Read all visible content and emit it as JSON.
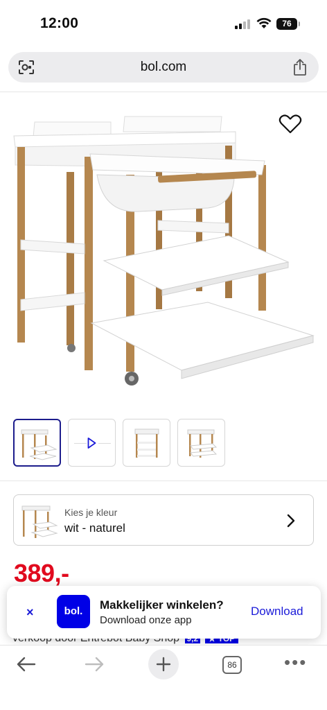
{
  "status_bar": {
    "time": "12:00",
    "battery": "76"
  },
  "browser": {
    "url": "bol.com"
  },
  "gallery": {
    "thumbnails": [
      {
        "kind": "image",
        "selected": true
      },
      {
        "kind": "video",
        "icon": "play-icon"
      },
      {
        "kind": "image"
      },
      {
        "kind": "image"
      }
    ]
  },
  "variant": {
    "label": "Kies je kleur",
    "value": "wit - naturel"
  },
  "product": {
    "price": "389,-",
    "seller_text": "verkoop door Entrebot Baby Shop",
    "seller_score": "9,2",
    "seller_badge": "TOP"
  },
  "app_banner": {
    "close_symbol": "×",
    "logo_text": "bol.",
    "title": "Makkelijker winkelen?",
    "subtitle": "Download onze app",
    "cta": "Download"
  },
  "bottom_nav": {
    "tabs_count": "86",
    "more_symbol": "•••"
  },
  "colors": {
    "price": "#e10a1e",
    "brand_blue": "#0000e6",
    "link_blue": "#1a1ad8",
    "selected_border": "#1c1c8c"
  }
}
